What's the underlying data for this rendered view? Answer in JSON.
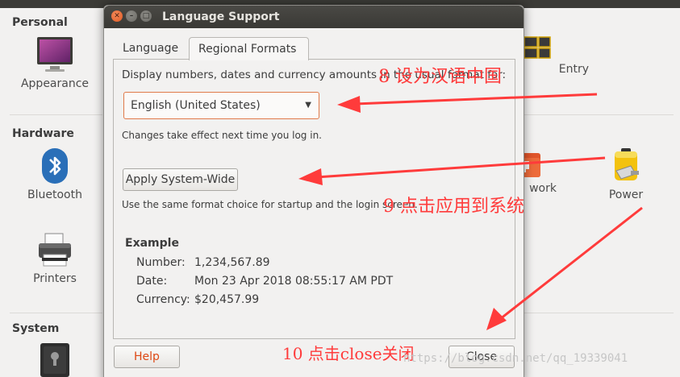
{
  "background": {
    "sections": [
      {
        "title": "Personal"
      },
      {
        "title": "Hardware"
      },
      {
        "title": "System"
      }
    ],
    "items": {
      "appearance": "Appearance",
      "bluetooth": "Bluetooth",
      "printers": "Printers",
      "entry": "Entry",
      "network": "work",
      "power": "Power"
    }
  },
  "dialog": {
    "title": "Language Support",
    "tabs": [
      {
        "label": "Language"
      },
      {
        "label": "Regional Formats"
      }
    ],
    "description": "Display numbers, dates and currency amounts in the usual format for:",
    "format_select": {
      "value": "English (United States)"
    },
    "change_note": "Changes take effect next time you log in.",
    "apply_button": "Apply System-Wide",
    "apply_note": "Use the same format choice for startup and the login screen.",
    "example": {
      "title": "Example",
      "rows": [
        {
          "label": "Number:",
          "value": "1,234,567.89"
        },
        {
          "label": "Date:",
          "value": "Mon 23 Apr 2018 08:55:17 AM PDT"
        },
        {
          "label": "Currency:",
          "value": "$20,457.99"
        }
      ]
    },
    "help_button": "Help",
    "close_button": "Close"
  },
  "annotations": {
    "step8": "8 设为汉语中国",
    "step9": "9 点击应用到系统",
    "step10": "10 点击close关闭",
    "arrow_color": "#ff3b3b"
  },
  "watermark": "https://blog.csdn.net/qq_19339041"
}
